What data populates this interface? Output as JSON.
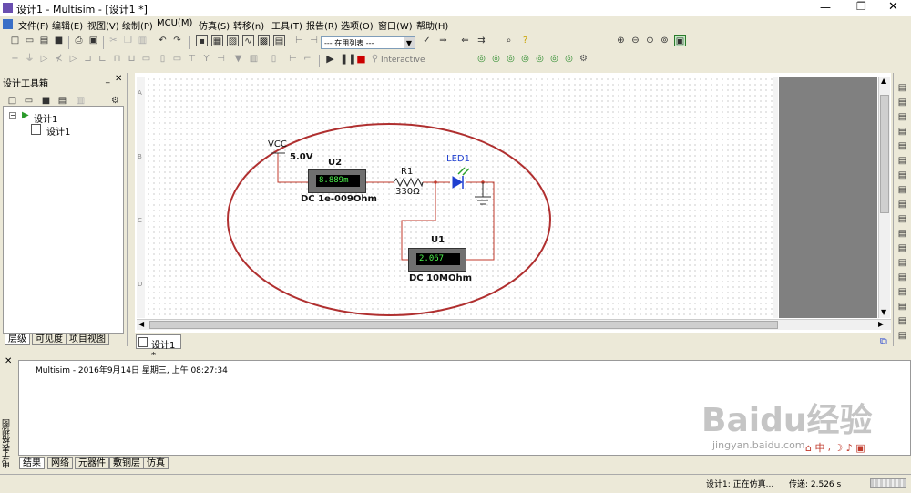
{
  "window": {
    "title": "设计1 - Multisim - [设计1 *]"
  },
  "menus": [
    "文件(F)",
    "编辑(E)",
    "视图(V)",
    "绘制(P)",
    "MCU(M)",
    "仿真(S)",
    "转移(n)",
    "工具(T)",
    "报告(R)",
    "选项(O)",
    "窗口(W)",
    "帮助(H)"
  ],
  "toolbar": {
    "in_use_list": "--- 在用列表 ---",
    "interactive": "Interactive"
  },
  "design_toolbox": {
    "title": "设计工具箱",
    "root": "设计1",
    "child": "设计1",
    "tabs": [
      "层级",
      "可见度",
      "项目视图"
    ]
  },
  "canvas": {
    "doc_tab": "设计1 *",
    "row_labels": [
      "A",
      "B",
      "C",
      "D"
    ]
  },
  "circuit": {
    "vcc_label": "VCC",
    "vcc_value": "5.0V",
    "u2_label": "U2",
    "u2_reading": "8.889m",
    "u2_desc": "DC  1e-009Ohm",
    "r1_label": "R1",
    "r1_value": "330Ω",
    "led_label": "LED1",
    "u1_label": "U1",
    "u1_reading": "2.067",
    "u1_desc": "DC  10MOhm"
  },
  "spreadsheet": {
    "side_title": "电子表格视图",
    "log_line": "Multisim  -  2016年9月14日 星期三, 上午 08:27:34",
    "tabs": [
      "结果",
      "网络",
      "元器件",
      "敷铜层",
      "仿真"
    ]
  },
  "status": {
    "sim_state": "设计1: 正在仿真...",
    "transient": "传递: 2.526 s"
  },
  "watermark": {
    "brand": "Baidu经验",
    "url": "jingyan.baidu.com"
  },
  "colors": {
    "wire": "#c0392b",
    "ellipse": "#b03030",
    "led": "#1f3fd0",
    "meter_display": "#4cf24c"
  }
}
